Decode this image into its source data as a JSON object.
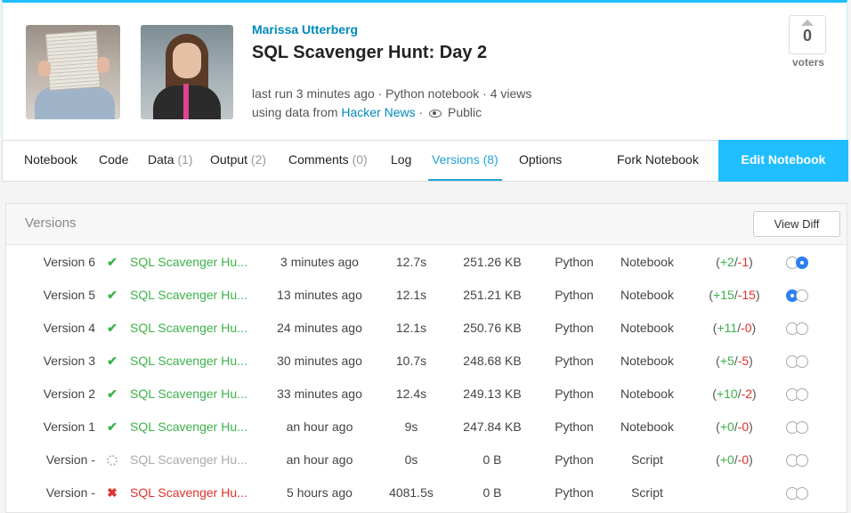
{
  "header": {
    "author": "Marissa Utterberg",
    "title": "SQL Scavenger Hunt: Day 2",
    "meta_line1": "last run 3 minutes ago · Python notebook · 4 views",
    "meta_line2_prefix": "using data from",
    "data_source": "Hacker News",
    "visibility": "Public",
    "votes": "0",
    "votes_label": "voters"
  },
  "tabs": [
    {
      "label": "Notebook",
      "count": ""
    },
    {
      "label": "Code",
      "count": ""
    },
    {
      "label": "Data",
      "count": "(1)"
    },
    {
      "label": "Output",
      "count": "(2)"
    },
    {
      "label": "Comments",
      "count": "(0)"
    },
    {
      "label": "Log",
      "count": ""
    },
    {
      "label": "Versions",
      "count": "(8)"
    },
    {
      "label": "Options",
      "count": ""
    }
  ],
  "fork_label": "Fork Notebook",
  "edit_label": "Edit Notebook",
  "versions": {
    "title": "Versions",
    "diff_label": "View Diff",
    "rows": [
      {
        "version": "Version 6",
        "status": "success",
        "title": "SQL Scavenger Hu...",
        "time": "3 minutes ago",
        "runtime": "12.7s",
        "size": "251.26 KB",
        "lang": "Python",
        "type": "Notebook",
        "plus": "+2",
        "minus": "-1"
      },
      {
        "version": "Version 5",
        "status": "success",
        "title": "SQL Scavenger Hu...",
        "time": "13 minutes ago",
        "runtime": "12.1s",
        "size": "251.21 KB",
        "lang": "Python",
        "type": "Notebook",
        "plus": "+15",
        "minus": "-15"
      },
      {
        "version": "Version 4",
        "status": "success",
        "title": "SQL Scavenger Hu...",
        "time": "24 minutes ago",
        "runtime": "12.1s",
        "size": "250.76 KB",
        "lang": "Python",
        "type": "Notebook",
        "plus": "+11",
        "minus": "-0"
      },
      {
        "version": "Version 3",
        "status": "success",
        "title": "SQL Scavenger Hu...",
        "time": "30 minutes ago",
        "runtime": "10.7s",
        "size": "248.68 KB",
        "lang": "Python",
        "type": "Notebook",
        "plus": "+5",
        "minus": "-5"
      },
      {
        "version": "Version 2",
        "status": "success",
        "title": "SQL Scavenger Hu...",
        "time": "33 minutes ago",
        "runtime": "12.4s",
        "size": "249.13 KB",
        "lang": "Python",
        "type": "Notebook",
        "plus": "+10",
        "minus": "-2"
      },
      {
        "version": "Version 1",
        "status": "success",
        "title": "SQL Scavenger Hu...",
        "time": "an hour ago",
        "runtime": "9s",
        "size": "247.84 KB",
        "lang": "Python",
        "type": "Notebook",
        "plus": "+0",
        "minus": "-0"
      },
      {
        "version": "Version -",
        "status": "pending",
        "title": "SQL Scavenger Hu...",
        "time": "an hour ago",
        "runtime": "0s",
        "size": "0 B",
        "lang": "Python",
        "type": "Script",
        "plus": "+0",
        "minus": "-0"
      },
      {
        "version": "Version -",
        "status": "error",
        "title": "SQL Scavenger Hu...",
        "time": "5 hours ago",
        "runtime": "4081.5s",
        "size": "0 B",
        "lang": "Python",
        "type": "Script",
        "plus": "",
        "minus": ""
      }
    ]
  }
}
